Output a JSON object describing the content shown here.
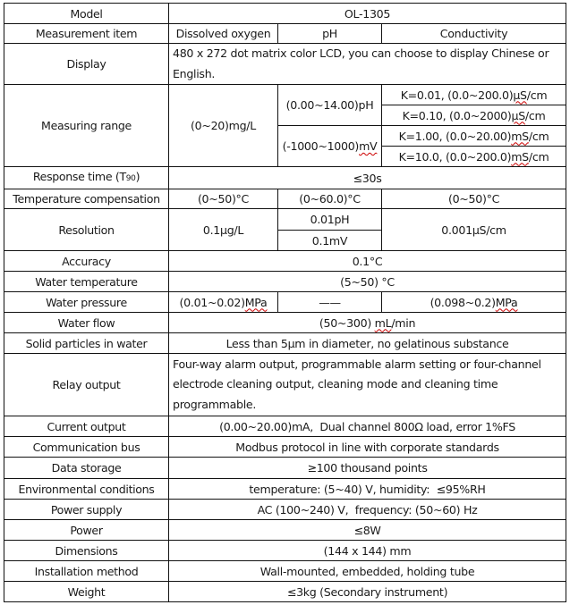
{
  "table": {
    "model": {
      "label": "Model",
      "value": "OL-1305"
    },
    "measurement_item": {
      "label": "Measurement item",
      "dissolved_oxygen": "Dissolved oxygen",
      "ph": "pH",
      "conductivity": "Conductivity"
    },
    "display": {
      "label": "Display",
      "value": "480 x 272 dot matrix color LCD, you can choose to display Chinese or English."
    },
    "measuring_range": {
      "label": "Measuring range",
      "do": "(0~20)mg/L",
      "ph_range": "(0.00~14.00)pH",
      "mv_range": "(-1000~1000)mV",
      "cond": [
        {
          "prefix": "K=0.01, (0.0~200.0)",
          "unit": "μS",
          "suffix": "/cm"
        },
        {
          "prefix": "K=0.10, (0.0~2000)",
          "unit": "μS",
          "suffix": "/cm"
        },
        {
          "prefix": "K=1.00, (0.0~20.00)",
          "unit": "mS",
          "suffix": "/cm"
        },
        {
          "prefix": "K=10.0, (0.0~200.0)",
          "unit": "mS",
          "suffix": "/cm"
        }
      ],
      "mv_prefix": "(-1000~1000)",
      "mv_unit": "mV"
    },
    "response_time": {
      "label_main": "Response time (T",
      "label_sub": "90",
      "label_end": ")",
      "value": "≤30s"
    },
    "temp_comp": {
      "label": "Temperature compensation",
      "do": "(0~50)°C",
      "ph": "(0~60.0)°C",
      "cond": "(0~50)°C"
    },
    "resolution": {
      "label": "Resolution",
      "do": "0.1μg/L",
      "ph": "0.01pH",
      "mv": "0.1mV",
      "cond": "0.001μS/cm"
    },
    "accuracy": {
      "label": "Accuracy",
      "value": "0.1°C"
    },
    "water_temp": {
      "label": "Water temperature",
      "value": "(5~50) °C"
    },
    "water_pressure": {
      "label": "Water pressure",
      "do_prefix": "(0.01~0.02)",
      "do_unit": "MPa",
      "ph": "——",
      "cond_prefix": "(0.098~0.2)",
      "cond_unit": "MPa"
    },
    "water_flow": {
      "label": "Water flow",
      "prefix": "(50~300) ",
      "unit": "mL",
      "suffix": "/min"
    },
    "solid_particles": {
      "label": "Solid particles in water",
      "value": "Less than 5μm in diameter, no gelatinous substance"
    },
    "relay_output": {
      "label": "Relay output",
      "value": "Four-way alarm output, programmable alarm setting or four-channel electrode cleaning output, cleaning mode and cleaning time programmable."
    },
    "current_output": {
      "label": "Current output",
      "value": "(0.00~20.00)mA,  Dual channel 800Ω load, error 1%FS"
    },
    "comm_bus": {
      "label": "Communication bus",
      "value": "Modbus protocol in line with corporate standards"
    },
    "data_storage": {
      "label": "Data storage",
      "value": "≥100 thousand points"
    },
    "env_conditions": {
      "label": "Environmental conditions",
      "value": "temperature: (5~40) V, humidity:  ≤95%RH"
    },
    "power_supply": {
      "label": "Power supply",
      "value": "AC (100~240) V,  frequency: (50~60) Hz"
    },
    "power": {
      "label": "Power",
      "value": "≤8W"
    },
    "dimensions": {
      "label": "Dimensions",
      "value": "(144 x 144) mm"
    },
    "installation": {
      "label": "Installation method",
      "value": "Wall-mounted, embedded, holding tube"
    },
    "weight": {
      "label": "Weight",
      "value": "≤3kg (Secondary instrument)"
    }
  }
}
